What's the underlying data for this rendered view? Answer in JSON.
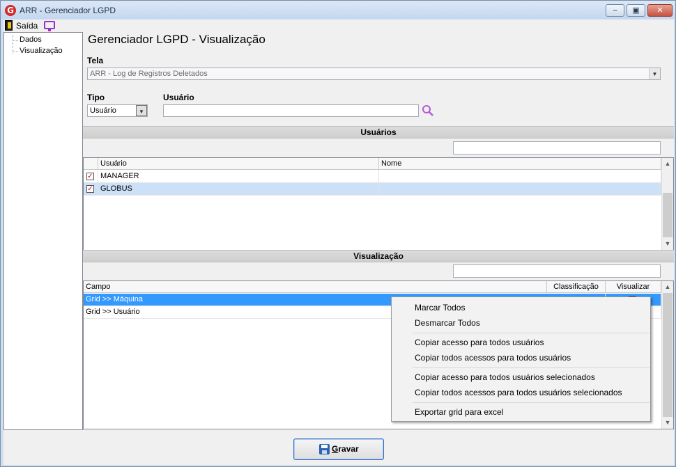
{
  "window": {
    "title": "ARR - Gerenciador LGPD",
    "logo_letter": "G"
  },
  "toolbar": {
    "exit_label": "Saída"
  },
  "tree": {
    "items": [
      "Dados",
      "Visualização"
    ]
  },
  "page": {
    "title": "Gerenciador LGPD - Visualização"
  },
  "tela": {
    "label": "Tela",
    "value": "ARR - Log de Registros Deletados"
  },
  "tipo": {
    "label": "Tipo",
    "value": "Usuário"
  },
  "usuario_filter": {
    "label": "Usuário",
    "value": ""
  },
  "users_section": {
    "header": "Usuários",
    "search_value": "",
    "columns": [
      "Usuário",
      "Nome"
    ],
    "rows": [
      {
        "checked": true,
        "usuario": "MANAGER",
        "nome": ""
      },
      {
        "checked": true,
        "usuario": "GLOBUS",
        "nome": ""
      }
    ]
  },
  "view_section": {
    "header": "Visualização",
    "search_value": "",
    "columns": [
      "Campo",
      "Classificação",
      "Visualizar"
    ],
    "rows": [
      {
        "campo": "Grid >> Máquina",
        "classificacao": "",
        "visualizar": false
      },
      {
        "campo": "Grid >> Usuário",
        "classificacao": "",
        "visualizar": false
      }
    ]
  },
  "context_menu": {
    "items": [
      "Marcar Todos",
      "Desmarcar Todos",
      "Copiar acesso para todos usuários",
      "Copiar todos acessos para todos usuários",
      "Copiar acesso para todos usuários selecionados",
      "Copiar todos acessos para todos usuários selecionados",
      "Exportar grid para excel"
    ]
  },
  "footer": {
    "save_label_rest": "ravar",
    "save_label_mnemonic": "G"
  },
  "colors": {
    "selection": "#3399ff",
    "selection_light": "#cce0f7",
    "title_bar": "#c4d7ef",
    "close_button": "#c75341",
    "accent_purple": "#9b2fc9",
    "check_red": "#cc0000"
  },
  "icons": {
    "logo": "globus-logo-icon",
    "exit": "exit-door-icon",
    "screen": "monitor-icon",
    "search": "magnifier-icon",
    "save": "floppy-disk-icon"
  }
}
